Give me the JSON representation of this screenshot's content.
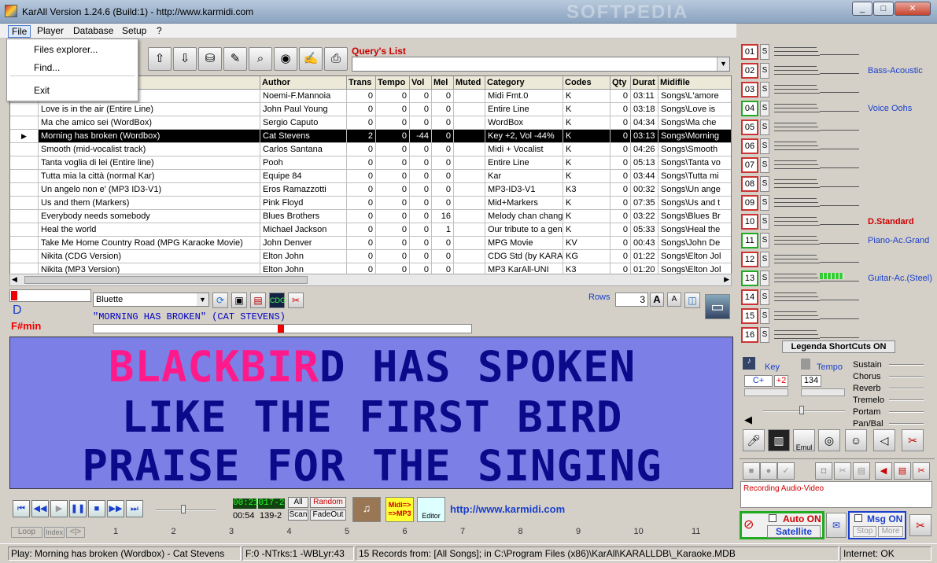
{
  "window": {
    "title": "KarAll Version 1.24.6 (Build:1) - http://www.karmidi.com",
    "watermark": "SOFTPEDIA"
  },
  "menu": {
    "items": [
      "File",
      "Player",
      "Database",
      "Setup",
      "?"
    ]
  },
  "file_menu": {
    "items": [
      "Files explorer...",
      "Find...",
      "Exit"
    ]
  },
  "query": {
    "label": "Query's List",
    "value": ""
  },
  "table": {
    "columns": [
      "",
      "Author",
      "Trans",
      "Tempo",
      "Vol",
      "Mel",
      "Muted",
      "Category",
      "Codes",
      "Qty",
      "Durat",
      "Midifile"
    ],
    "rows": [
      {
        "title": "",
        "author": "Noemi-F.Mannoia",
        "trans": "0",
        "tempo": "0",
        "vol": "0",
        "mel": "0",
        "muted": "",
        "category": "Midi Fmt.0",
        "codes": "K",
        "qty": "0",
        "durat": "03:11",
        "file": "Songs\\L'amore"
      },
      {
        "title": "Love is in the air (Entire Line)",
        "author": "John Paul Young",
        "trans": "0",
        "tempo": "0",
        "vol": "0",
        "mel": "0",
        "muted": "",
        "category": "Entire Line",
        "codes": "K",
        "qty": "0",
        "durat": "03:18",
        "file": "Songs\\Love is"
      },
      {
        "title": "Ma che amico sei (WordBox)",
        "author": "Sergio Caputo",
        "trans": "0",
        "tempo": "0",
        "vol": "0",
        "mel": "0",
        "muted": "",
        "category": "WordBox",
        "codes": "K",
        "qty": "0",
        "durat": "04:34",
        "file": "Songs\\Ma che"
      },
      {
        "title": "Morning has broken (Wordbox)",
        "author": "Cat Stevens",
        "trans": "2",
        "tempo": "0",
        "vol": "-44",
        "mel": "0",
        "muted": "",
        "category": "Key +2, Vol -44%",
        "codes": "K",
        "qty": "0",
        "durat": "03:13",
        "file": "Songs\\Morning"
      },
      {
        "title": "Smooth (mid-vocalist track)",
        "author": "Carlos Santana",
        "trans": "0",
        "tempo": "0",
        "vol": "0",
        "mel": "0",
        "muted": "",
        "category": "Midi + Vocalist",
        "codes": "K",
        "qty": "0",
        "durat": "04:26",
        "file": "Songs\\Smooth"
      },
      {
        "title": "Tanta voglia di lei (Entire line)",
        "author": "Pooh",
        "trans": "0",
        "tempo": "0",
        "vol": "0",
        "mel": "0",
        "muted": "",
        "category": "Entire Line",
        "codes": "K",
        "qty": "0",
        "durat": "05:13",
        "file": "Songs\\Tanta vo"
      },
      {
        "title": "Tutta mia la città (normal Kar)",
        "author": "Equipe 84",
        "trans": "0",
        "tempo": "0",
        "vol": "0",
        "mel": "0",
        "muted": "",
        "category": "Kar",
        "codes": "K",
        "qty": "0",
        "durat": "03:44",
        "file": "Songs\\Tutta mi"
      },
      {
        "title": "Un angelo non e' (MP3 ID3-V1)",
        "author": "Eros Ramazzotti",
        "trans": "0",
        "tempo": "0",
        "vol": "0",
        "mel": "0",
        "muted": "",
        "category": "MP3-ID3-V1",
        "codes": "K3",
        "qty": "0",
        "durat": "00:32",
        "file": "Songs\\Un ange"
      },
      {
        "title": "Us and them (Markers)",
        "author": "Pink Floyd",
        "trans": "0",
        "tempo": "0",
        "vol": "0",
        "mel": "0",
        "muted": "",
        "category": "Mid+Markers",
        "codes": "K",
        "qty": "0",
        "durat": "07:35",
        "file": "Songs\\Us and t"
      },
      {
        "title": "Everybody needs somebody",
        "author": "Blues Brothers",
        "trans": "0",
        "tempo": "0",
        "vol": "0",
        "mel": "16",
        "muted": "",
        "category": "Melody chan chang",
        "codes": "K",
        "qty": "0",
        "durat": "03:22",
        "file": "Songs\\Blues Br"
      },
      {
        "title": "Heal the world",
        "author": "Michael Jackson",
        "trans": "0",
        "tempo": "0",
        "vol": "0",
        "mel": "1",
        "muted": "",
        "category": "Our tribute to a geni",
        "codes": "K",
        "qty": "0",
        "durat": "05:33",
        "file": "Songs\\Heal the"
      },
      {
        "title": "Take Me Home Country Road (MPG Karaoke Movie)",
        "author": "John Denver",
        "trans": "0",
        "tempo": "0",
        "vol": "0",
        "mel": "0",
        "muted": "",
        "category": "MPG Movie",
        "codes": "KV",
        "qty": "0",
        "durat": "00:43",
        "file": "Songs\\John De"
      },
      {
        "title": "Nikita (CDG Version)",
        "author": "Elton John",
        "trans": "0",
        "tempo": "0",
        "vol": "0",
        "mel": "0",
        "muted": "",
        "category": "CDG Std (by KARAI",
        "codes": "KG",
        "qty": "0",
        "durat": "01:22",
        "file": "Songs\\Elton Jol"
      },
      {
        "title": "Nikita (MP3 Version)",
        "author": "Elton John",
        "trans": "0",
        "tempo": "0",
        "vol": "0",
        "mel": "0",
        "muted": "",
        "category": "MP3 KarAll-UNI",
        "codes": "K3",
        "qty": "0",
        "durat": "01:20",
        "file": "Songs\\Elton Jol"
      }
    ]
  },
  "display": {
    "key_note": "D",
    "chord": "F#min",
    "font": "Bluette",
    "rows_label": "Rows",
    "rows_value": "3",
    "a_big": "A",
    "a_small": "A",
    "song_label": "\"MORNING HAS BROKEN\" (CAT STEVENS)"
  },
  "lyrics": {
    "line1_hl": "BLACKBIR",
    "line1_rest": "D HAS SPOKEN",
    "line2": "LIKE THE FIRST BIRD",
    "line3": "PRAISE FOR THE SINGING"
  },
  "transport": {
    "time_elapsed": "00:21",
    "time_total": "00:54",
    "tracks": "017-2",
    "tracks2": "139-2",
    "all": "All",
    "random": "Random",
    "scan": "Scan",
    "fadeout": "FadeOut",
    "midi_mp3": "Midi=> =>MP3",
    "mp3_editor": "Editor",
    "url": "http://www.karmidi.com",
    "loop": "Loop",
    "index": "Index",
    "nav": "<|>"
  },
  "numbers": [
    "1",
    "2",
    "3",
    "4",
    "5",
    "6",
    "7",
    "8",
    "9",
    "10",
    "11"
  ],
  "status": {
    "play": "Play: Morning has broken (Wordbox) - Cat Stevens",
    "info": "F:0 -NTrks:1 -WBLyr:43",
    "records": "15 Records from: [All Songs]; in C:\\Program Files (x86)\\KarAll\\KARALLDB\\_Karaoke.MDB",
    "zone": "Internet: OK"
  },
  "channels": [
    {
      "n": "01",
      "inst": ""
    },
    {
      "n": "02",
      "inst": "Bass-Acoustic"
    },
    {
      "n": "03",
      "inst": ""
    },
    {
      "n": "04",
      "inst": "Voice Oohs"
    },
    {
      "n": "05",
      "inst": ""
    },
    {
      "n": "06",
      "inst": ""
    },
    {
      "n": "07",
      "inst": ""
    },
    {
      "n": "08",
      "inst": ""
    },
    {
      "n": "09",
      "inst": ""
    },
    {
      "n": "10",
      "inst": "D.Standard"
    },
    {
      "n": "11",
      "inst": "Piano-Ac.Grand"
    },
    {
      "n": "12",
      "inst": ""
    },
    {
      "n": "13",
      "inst": "Guitar-Ac.(Steel)"
    },
    {
      "n": "14",
      "inst": ""
    },
    {
      "n": "15",
      "inst": ""
    },
    {
      "n": "16",
      "inst": ""
    }
  ],
  "mixer": {
    "legend": "Legenda ShortCuts ON",
    "key": "Key",
    "tempo": "Tempo",
    "key_val": "C+",
    "key_shift": "+2",
    "tempo_val": "134",
    "sustain": "Sustain",
    "chorus": "Chorus",
    "reverb": "Reverb",
    "tremelo": "Tremelo",
    "portam": "Portam",
    "panbal": "Pan/Bal",
    "emul": "Emul",
    "recording": "Recording Audio-Video",
    "auto_on": "Auto ON",
    "satellite": "Satellite",
    "msg_on": "Msg ON",
    "stop": "Stop",
    "more": "More"
  }
}
